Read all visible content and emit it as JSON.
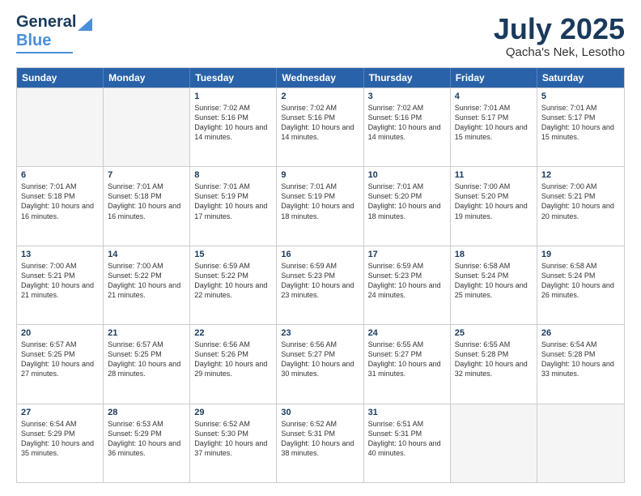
{
  "header": {
    "logo": {
      "line1": "General",
      "line2": "Blue"
    },
    "title": "July 2025",
    "subtitle": "Qacha's Nek, Lesotho"
  },
  "calendar": {
    "days": [
      "Sunday",
      "Monday",
      "Tuesday",
      "Wednesday",
      "Thursday",
      "Friday",
      "Saturday"
    ],
    "weeks": [
      [
        {
          "day": "",
          "empty": true
        },
        {
          "day": "",
          "empty": true
        },
        {
          "day": "1",
          "sunrise": "Sunrise: 7:02 AM",
          "sunset": "Sunset: 5:16 PM",
          "daylight": "Daylight: 10 hours and 14 minutes."
        },
        {
          "day": "2",
          "sunrise": "Sunrise: 7:02 AM",
          "sunset": "Sunset: 5:16 PM",
          "daylight": "Daylight: 10 hours and 14 minutes."
        },
        {
          "day": "3",
          "sunrise": "Sunrise: 7:02 AM",
          "sunset": "Sunset: 5:16 PM",
          "daylight": "Daylight: 10 hours and 14 minutes."
        },
        {
          "day": "4",
          "sunrise": "Sunrise: 7:01 AM",
          "sunset": "Sunset: 5:17 PM",
          "daylight": "Daylight: 10 hours and 15 minutes."
        },
        {
          "day": "5",
          "sunrise": "Sunrise: 7:01 AM",
          "sunset": "Sunset: 5:17 PM",
          "daylight": "Daylight: 10 hours and 15 minutes."
        }
      ],
      [
        {
          "day": "6",
          "sunrise": "Sunrise: 7:01 AM",
          "sunset": "Sunset: 5:18 PM",
          "daylight": "Daylight: 10 hours and 16 minutes."
        },
        {
          "day": "7",
          "sunrise": "Sunrise: 7:01 AM",
          "sunset": "Sunset: 5:18 PM",
          "daylight": "Daylight: 10 hours and 16 minutes."
        },
        {
          "day": "8",
          "sunrise": "Sunrise: 7:01 AM",
          "sunset": "Sunset: 5:19 PM",
          "daylight": "Daylight: 10 hours and 17 minutes."
        },
        {
          "day": "9",
          "sunrise": "Sunrise: 7:01 AM",
          "sunset": "Sunset: 5:19 PM",
          "daylight": "Daylight: 10 hours and 18 minutes."
        },
        {
          "day": "10",
          "sunrise": "Sunrise: 7:01 AM",
          "sunset": "Sunset: 5:20 PM",
          "daylight": "Daylight: 10 hours and 18 minutes."
        },
        {
          "day": "11",
          "sunrise": "Sunrise: 7:00 AM",
          "sunset": "Sunset: 5:20 PM",
          "daylight": "Daylight: 10 hours and 19 minutes."
        },
        {
          "day": "12",
          "sunrise": "Sunrise: 7:00 AM",
          "sunset": "Sunset: 5:21 PM",
          "daylight": "Daylight: 10 hours and 20 minutes."
        }
      ],
      [
        {
          "day": "13",
          "sunrise": "Sunrise: 7:00 AM",
          "sunset": "Sunset: 5:21 PM",
          "daylight": "Daylight: 10 hours and 21 minutes."
        },
        {
          "day": "14",
          "sunrise": "Sunrise: 7:00 AM",
          "sunset": "Sunset: 5:22 PM",
          "daylight": "Daylight: 10 hours and 21 minutes."
        },
        {
          "day": "15",
          "sunrise": "Sunrise: 6:59 AM",
          "sunset": "Sunset: 5:22 PM",
          "daylight": "Daylight: 10 hours and 22 minutes."
        },
        {
          "day": "16",
          "sunrise": "Sunrise: 6:59 AM",
          "sunset": "Sunset: 5:23 PM",
          "daylight": "Daylight: 10 hours and 23 minutes."
        },
        {
          "day": "17",
          "sunrise": "Sunrise: 6:59 AM",
          "sunset": "Sunset: 5:23 PM",
          "daylight": "Daylight: 10 hours and 24 minutes."
        },
        {
          "day": "18",
          "sunrise": "Sunrise: 6:58 AM",
          "sunset": "Sunset: 5:24 PM",
          "daylight": "Daylight: 10 hours and 25 minutes."
        },
        {
          "day": "19",
          "sunrise": "Sunrise: 6:58 AM",
          "sunset": "Sunset: 5:24 PM",
          "daylight": "Daylight: 10 hours and 26 minutes."
        }
      ],
      [
        {
          "day": "20",
          "sunrise": "Sunrise: 6:57 AM",
          "sunset": "Sunset: 5:25 PM",
          "daylight": "Daylight: 10 hours and 27 minutes."
        },
        {
          "day": "21",
          "sunrise": "Sunrise: 6:57 AM",
          "sunset": "Sunset: 5:25 PM",
          "daylight": "Daylight: 10 hours and 28 minutes."
        },
        {
          "day": "22",
          "sunrise": "Sunrise: 6:56 AM",
          "sunset": "Sunset: 5:26 PM",
          "daylight": "Daylight: 10 hours and 29 minutes."
        },
        {
          "day": "23",
          "sunrise": "Sunrise: 6:56 AM",
          "sunset": "Sunset: 5:27 PM",
          "daylight": "Daylight: 10 hours and 30 minutes."
        },
        {
          "day": "24",
          "sunrise": "Sunrise: 6:55 AM",
          "sunset": "Sunset: 5:27 PM",
          "daylight": "Daylight: 10 hours and 31 minutes."
        },
        {
          "day": "25",
          "sunrise": "Sunrise: 6:55 AM",
          "sunset": "Sunset: 5:28 PM",
          "daylight": "Daylight: 10 hours and 32 minutes."
        },
        {
          "day": "26",
          "sunrise": "Sunrise: 6:54 AM",
          "sunset": "Sunset: 5:28 PM",
          "daylight": "Daylight: 10 hours and 33 minutes."
        }
      ],
      [
        {
          "day": "27",
          "sunrise": "Sunrise: 6:54 AM",
          "sunset": "Sunset: 5:29 PM",
          "daylight": "Daylight: 10 hours and 35 minutes."
        },
        {
          "day": "28",
          "sunrise": "Sunrise: 6:53 AM",
          "sunset": "Sunset: 5:29 PM",
          "daylight": "Daylight: 10 hours and 36 minutes."
        },
        {
          "day": "29",
          "sunrise": "Sunrise: 6:52 AM",
          "sunset": "Sunset: 5:30 PM",
          "daylight": "Daylight: 10 hours and 37 minutes."
        },
        {
          "day": "30",
          "sunrise": "Sunrise: 6:52 AM",
          "sunset": "Sunset: 5:31 PM",
          "daylight": "Daylight: 10 hours and 38 minutes."
        },
        {
          "day": "31",
          "sunrise": "Sunrise: 6:51 AM",
          "sunset": "Sunset: 5:31 PM",
          "daylight": "Daylight: 10 hours and 40 minutes."
        },
        {
          "day": "",
          "empty": true
        },
        {
          "day": "",
          "empty": true
        }
      ]
    ]
  }
}
